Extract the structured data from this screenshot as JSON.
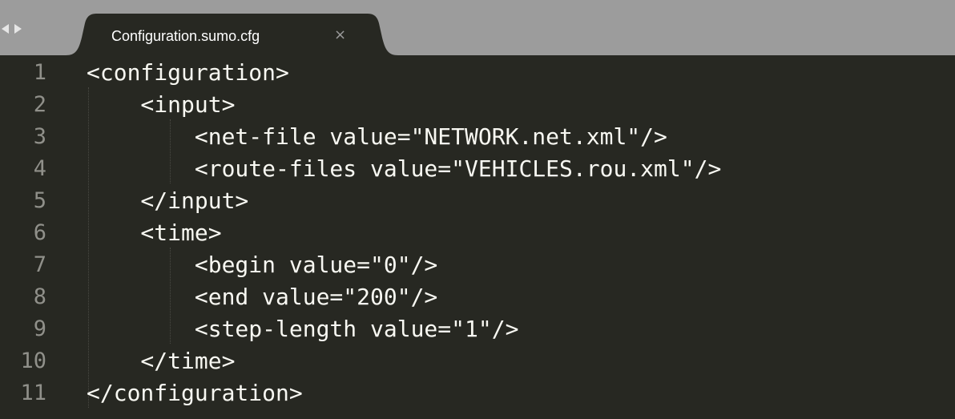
{
  "tabbar": {
    "tabs": [
      {
        "title": "Configuration.sumo.cfg",
        "close_glyph": "×",
        "active": true
      }
    ]
  },
  "editor": {
    "lines": [
      {
        "number": "1",
        "text": "<configuration>"
      },
      {
        "number": "2",
        "text": "    <input>"
      },
      {
        "number": "3",
        "text": "        <net-file value=\"NETWORK.net.xml\"/>"
      },
      {
        "number": "4",
        "text": "        <route-files value=\"VEHICLES.rou.xml\"/>"
      },
      {
        "number": "5",
        "text": "    </input>"
      },
      {
        "number": "6",
        "text": "    <time>"
      },
      {
        "number": "7",
        "text": "        <begin value=\"0\"/>"
      },
      {
        "number": "8",
        "text": "        <end value=\"200\"/>"
      },
      {
        "number": "9",
        "text": "        <step-length value=\"1\"/>"
      },
      {
        "number": "10",
        "text": "    </time>"
      },
      {
        "number": "11",
        "text": "</configuration>"
      }
    ]
  },
  "theme": {
    "background": "#272822",
    "tabbar": "#9c9c9c",
    "text": "#f8f8f2",
    "gutter_text": "#90908a"
  },
  "icons": {
    "back": "nav-back-icon",
    "forward": "nav-forward-icon",
    "close": "close-icon"
  }
}
